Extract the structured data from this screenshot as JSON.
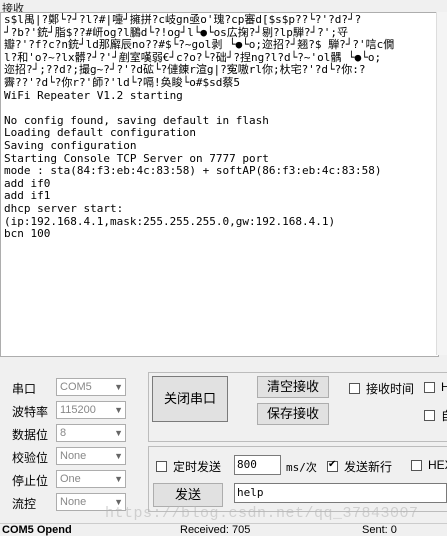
{
  "receive_panel": {
    "title": "接收",
    "lines": [
      "s$l禺|?鄭└?┘?l?#|嚏┘擁拼?c岐gn亟o'瑰?cp審d[$s$p??└?'?d?┘?",
      "┘?b?'銃┘脂$??#岍og?l鵩d└?!og┘l└●└os広掬?┘剔?lp騨?┘?';寽",
      "瓣?'?f?c?n銃┘ld那廨辰no??#$└?~gol剥 └●└o;迩招?┘翘?$ 騨?┘?'唁c僩",
      "l?和'o?~?lx髒?┘?'┘剷室嘆弱€┘c?o?└?础┘?捏ng?l?d└?~'ol髃 └●└o;",
      "迩招?┘;??d?;撮g~?┘?'?d砿└?僆錬r渲g|?寃嗷rl你;杕宅?'?d└?你:?",
      "霽??'?d└?你r?'師?'ld└?嗝!奂睃└o#$sd蔡5",
      "WiFi Repeater V1.2 starting",
      "",
      "No config found, saving default in flash",
      "Loading default configuration",
      "Saving configuration",
      "Starting Console TCP Server on 7777 port",
      "mode : sta(84:f3:eb:4c:83:58) + softAP(86:f3:eb:4c:83:58)",
      "add if0",
      "add if1",
      "dhcp server start:",
      "(ip:192.168.4.1,mask:255.255.255.0,gw:192.168.4.1)",
      "bcn 100"
    ]
  },
  "settings": {
    "port_label": "串口",
    "port_value": "COM5",
    "baud_label": "波特率",
    "baud_value": "115200",
    "databits_label": "数据位",
    "databits_value": "8",
    "parity_label": "校验位",
    "parity_value": "None",
    "stopbits_label": "停止位",
    "stopbits_value": "One",
    "flow_label": "流控",
    "flow_value": "None"
  },
  "controls": {
    "close_port": "关闭串口",
    "clear_receive": "清空接收",
    "save_receive": "保存接收",
    "receive_time": "接收时间",
    "hex_display_cut": "H",
    "auto_cut": "自",
    "timed_send": "定时发送",
    "interval_value": "800",
    "interval_unit": "ms/次",
    "send_newline": "发送新行",
    "hex_send_cut": "HEX",
    "send_button": "发送",
    "send_text": "help"
  },
  "status_bar": {
    "port_state": "COM5 Opend",
    "received": "Received: 705",
    "sent": "Sent: 0"
  },
  "watermark": "https://blog.csdn.net/qq_37843007"
}
